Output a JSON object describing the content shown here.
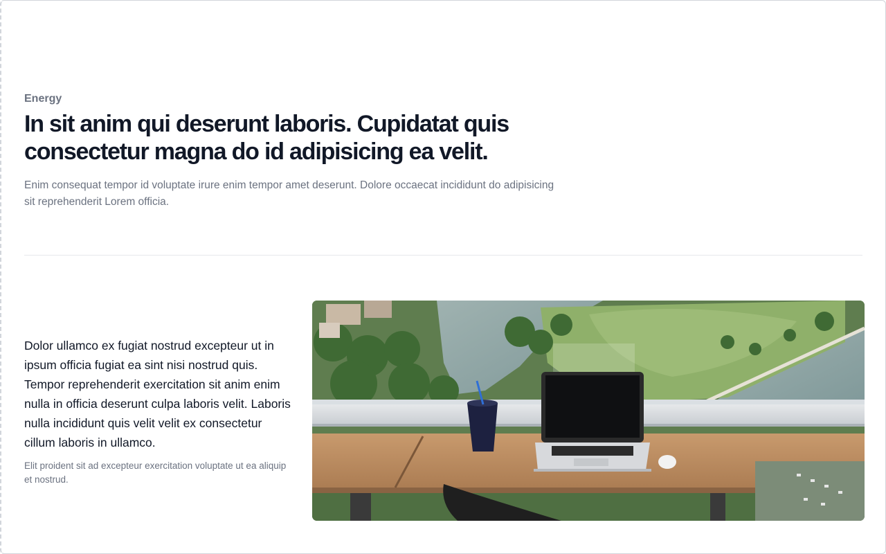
{
  "hero": {
    "eyebrow": "Energy",
    "title": "In sit anim qui deserunt laboris. Cupidatat quis consectetur magna do id adipisicing ea velit.",
    "subtitle": "Enim consequat tempor id voluptate irure enim tempor amet deserunt. Dolore occaecat incididunt do adipisicing sit reprehenderit Lorem officia."
  },
  "feature": {
    "lead": "Dolor ullamco ex fugiat nostrud excepteur ut in ipsum officia fugiat ea sint nisi nostrud quis. Tempor reprehenderit exercitation sit anim enim nulla in officia deserunt culpa laboris velit. Laboris nulla incididunt quis velit velit ex consectetur cillum laboris in ullamco.",
    "note": "Elit proident sit ad excepteur exercitation voluptate ut ea aliquip et nostrud.",
    "image": {
      "icon": "photo-laptop-desk-city-view"
    }
  },
  "colors": {
    "heading": "#111827",
    "muted": "#6b7280",
    "divider": "#e5e7eb"
  }
}
